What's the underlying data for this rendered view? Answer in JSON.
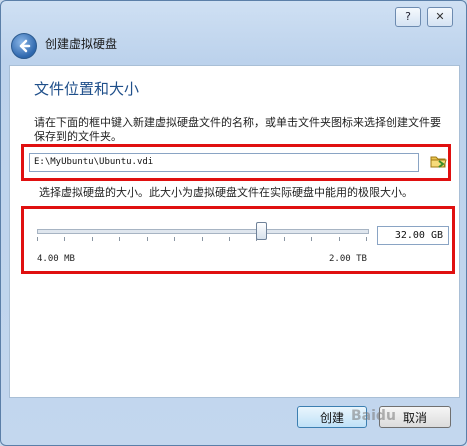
{
  "window": {
    "title": "创建虚拟硬盘",
    "help_label": "?",
    "close_label": "✕"
  },
  "page": {
    "heading": "文件位置和大小",
    "description": "请在下面的框中键入新建虚拟硬盘文件的名称，或单击文件夹图标来选择创建文件要保存到的文件夹。"
  },
  "file": {
    "path_value": "E:\\MyUbuntu\\Ubuntu.vdi"
  },
  "size": {
    "description": "选择虚拟硬盘的大小。此大小为虚拟硬盘文件在实际硬盘中能用的极限大小。",
    "value": "32.00 GB",
    "min_label": "4.00 MB",
    "max_label": "2.00 TB",
    "slider_fraction": 0.68
  },
  "buttons": {
    "create": "创建",
    "cancel": "取消"
  },
  "watermark": "Baidu",
  "colors": {
    "highlight": "#e01010",
    "heading": "#1f4f8a"
  }
}
